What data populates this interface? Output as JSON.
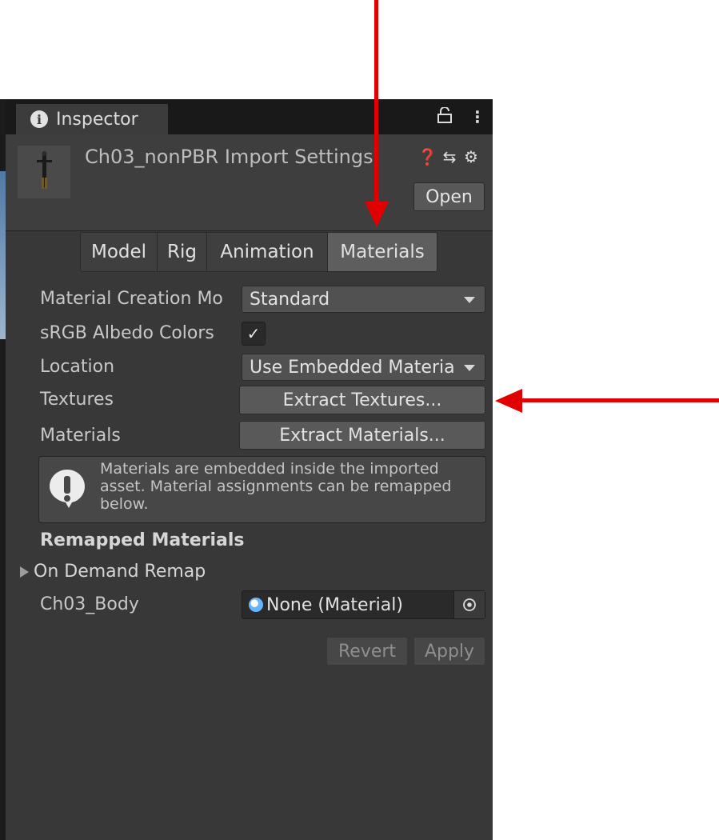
{
  "window": {
    "tab_label": "Inspector",
    "title": "Ch03_nonPBR Import Settings",
    "open_label": "Open"
  },
  "tabs": [
    {
      "label": "Model"
    },
    {
      "label": "Rig"
    },
    {
      "label": "Animation"
    },
    {
      "label": "Materials",
      "active": true
    }
  ],
  "fields": {
    "material_creation_mode": {
      "label": "Material Creation Mo",
      "value": "Standard"
    },
    "srgb_albedo": {
      "label": "sRGB Albedo Colors",
      "checked": true
    },
    "location": {
      "label": "Location",
      "value": "Use Embedded Materia"
    },
    "textures": {
      "label": "Textures",
      "button": "Extract Textures..."
    },
    "materials": {
      "label": "Materials",
      "button": "Extract Materials..."
    }
  },
  "help": {
    "message": "Materials are embedded inside the imported asset. Material assignments can be remapped below."
  },
  "remapped": {
    "section_title": "Remapped Materials",
    "foldout_label": "On Demand Remap",
    "body_label": "Ch03_Body",
    "body_value": "None (Material)"
  },
  "footer": {
    "revert_label": "Revert",
    "apply_label": "Apply"
  },
  "icons": [
    "info-icon",
    "lock-icon",
    "kebab-menu-icon",
    "help-icon",
    "preset-icon",
    "gear-icon",
    "warning-icon",
    "object-picker-icon"
  ],
  "colors": {
    "panel_bg": "#383838",
    "active_tab": "#5e5e5e",
    "annotation_arrow": "#e00000"
  }
}
